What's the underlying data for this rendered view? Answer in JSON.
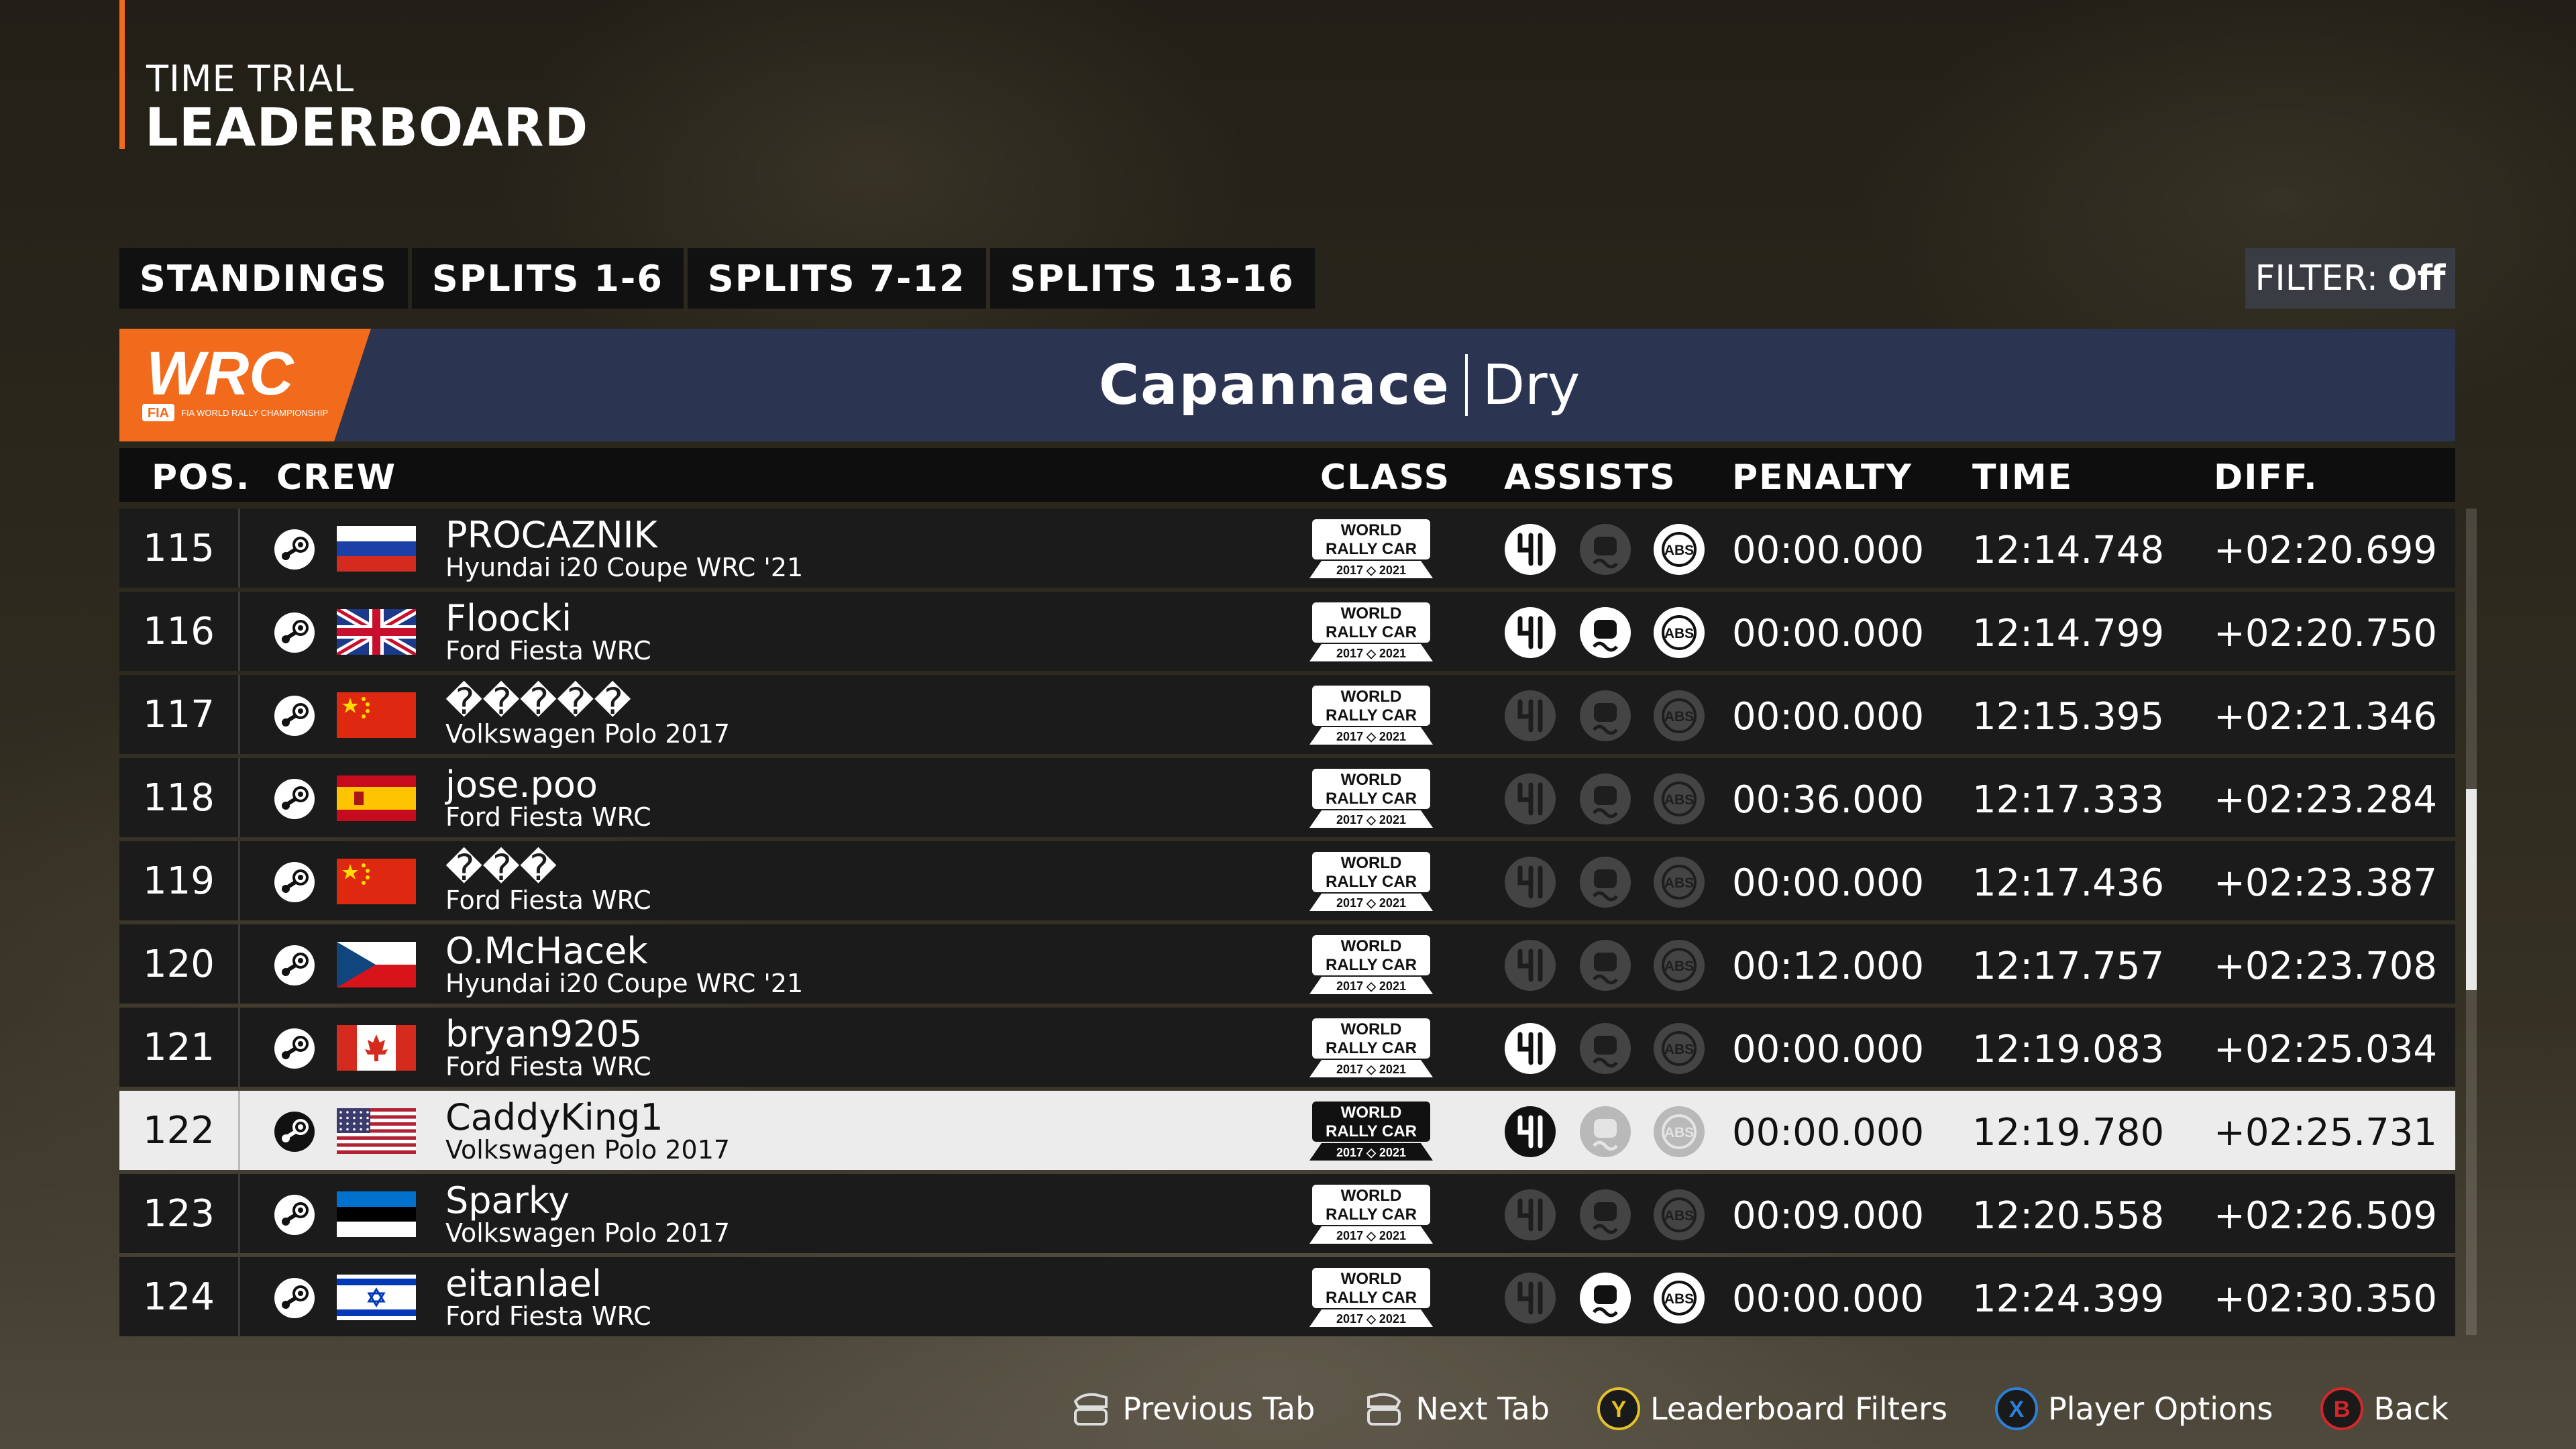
{
  "header": {
    "subtitle": "TIME TRIAL",
    "title": "LEADERBOARD"
  },
  "tabs": [
    "STANDINGS",
    "SPLITS 1-6",
    "SPLITS 7-12",
    "SPLITS 13-16"
  ],
  "filter": {
    "label": "FILTER:",
    "value": "Off"
  },
  "event": {
    "location": "Capannace",
    "condition": "Dry"
  },
  "columns": {
    "pos": "POS.",
    "crew": "CREW",
    "class": "CLASS",
    "assists": "ASSISTS",
    "penalty": "PENALTY",
    "time": "TIME",
    "diff": "DIFF."
  },
  "class_badge": {
    "line1": "WORLD",
    "line2": "RALLY CAR",
    "years": "2017 ◇ 2021"
  },
  "colors": {
    "accent": "#f26a1b",
    "titlebar": "#2b3551",
    "row": "#1b1b1b",
    "highlight": "#ececec"
  },
  "rows": [
    {
      "pos": "115",
      "name": "PROCAZNIK",
      "car": "Hyundai i20 Coupe WRC '21",
      "flag": "russia",
      "penalty": "00:00.000",
      "time": "12:14.748",
      "diff": "+02:20.699",
      "assists": [
        true,
        false,
        true
      ],
      "me": false
    },
    {
      "pos": "116",
      "name": "Floocki",
      "car": "Ford Fiesta WRC",
      "flag": "uk",
      "penalty": "00:00.000",
      "time": "12:14.799",
      "diff": "+02:20.750",
      "assists": [
        true,
        true,
        true
      ],
      "me": false
    },
    {
      "pos": "117",
      "name": "�����",
      "car": "Volkswagen Polo 2017",
      "flag": "china",
      "penalty": "00:00.000",
      "time": "12:15.395",
      "diff": "+02:21.346",
      "assists": [
        false,
        false,
        false
      ],
      "me": false
    },
    {
      "pos": "118",
      "name": "jose.poo",
      "car": "Ford Fiesta WRC",
      "flag": "spain",
      "penalty": "00:36.000",
      "time": "12:17.333",
      "diff": "+02:23.284",
      "assists": [
        false,
        false,
        false
      ],
      "me": false
    },
    {
      "pos": "119",
      "name": "���",
      "car": "Ford Fiesta WRC",
      "flag": "china",
      "penalty": "00:00.000",
      "time": "12:17.436",
      "diff": "+02:23.387",
      "assists": [
        false,
        false,
        false
      ],
      "me": false
    },
    {
      "pos": "120",
      "name": "O.McHacek",
      "car": "Hyundai i20 Coupe WRC '21",
      "flag": "czech",
      "penalty": "00:12.000",
      "time": "12:17.757",
      "diff": "+02:23.708",
      "assists": [
        false,
        false,
        false
      ],
      "me": false
    },
    {
      "pos": "121",
      "name": "bryan9205",
      "car": "Ford Fiesta WRC",
      "flag": "canada",
      "penalty": "00:00.000",
      "time": "12:19.083",
      "diff": "+02:25.034",
      "assists": [
        true,
        false,
        false
      ],
      "me": false
    },
    {
      "pos": "122",
      "name": "CaddyKing1",
      "car": "Volkswagen Polo 2017",
      "flag": "usa",
      "penalty": "00:00.000",
      "time": "12:19.780",
      "diff": "+02:25.731",
      "assists": [
        true,
        false,
        false
      ],
      "me": true
    },
    {
      "pos": "123",
      "name": "Sparky",
      "car": "Volkswagen Polo 2017",
      "flag": "estonia",
      "penalty": "00:09.000",
      "time": "12:20.558",
      "diff": "+02:26.509",
      "assists": [
        false,
        false,
        false
      ],
      "me": false
    },
    {
      "pos": "124",
      "name": "eitanlael",
      "car": "Ford Fiesta WRC",
      "flag": "israel",
      "penalty": "00:00.000",
      "time": "12:24.399",
      "diff": "+02:30.350",
      "assists": [
        false,
        true,
        true
      ],
      "me": false
    }
  ],
  "footer": [
    {
      "icon": "lb-bumper-icon",
      "label": "Previous Tab"
    },
    {
      "icon": "rb-bumper-icon",
      "label": "Next Tab"
    },
    {
      "icon": "y-button-icon",
      "label": "Leaderboard Filters",
      "color": "#e3c12a"
    },
    {
      "icon": "x-button-icon",
      "label": "Player Options",
      "color": "#2e7fd6"
    },
    {
      "icon": "b-button-icon",
      "label": "Back",
      "color": "#d4272a"
    }
  ],
  "wrc_logo": {
    "text": "WRC",
    "sub": "FIA WORLD RALLY CHAMPIONSHIP"
  }
}
